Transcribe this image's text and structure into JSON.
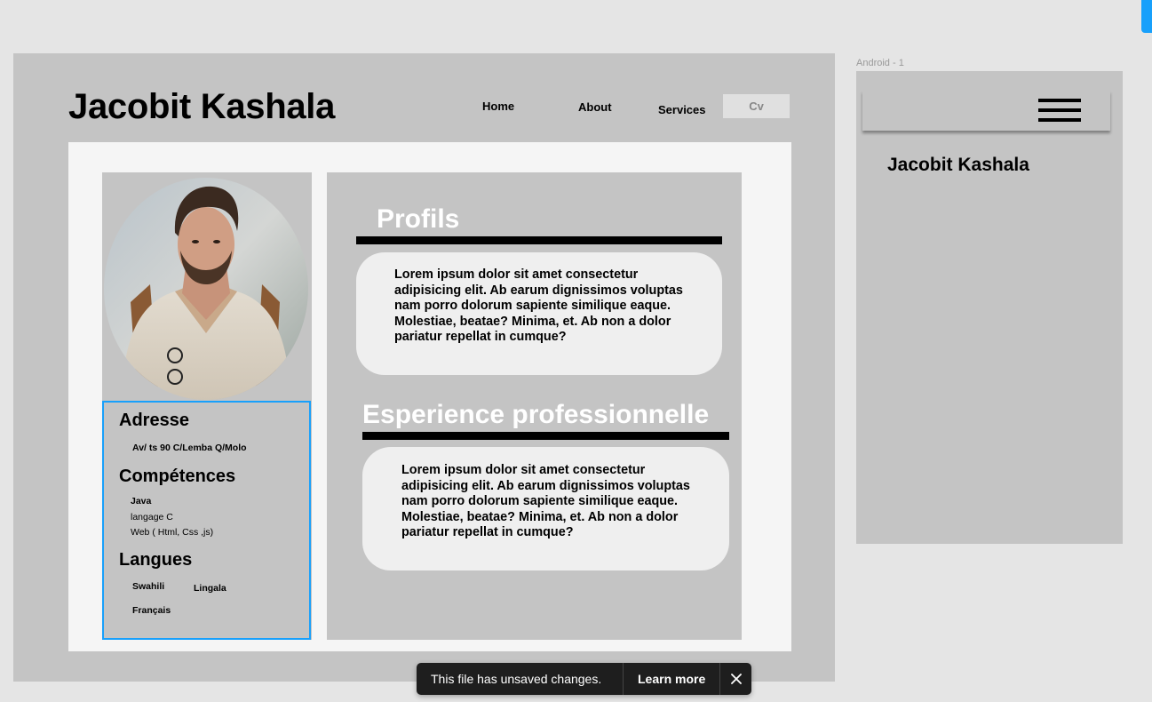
{
  "desktop": {
    "site_title": "Jacobit Kashala",
    "nav": {
      "home": "Home",
      "about": "About",
      "services": "Services",
      "cv": "Cv"
    },
    "sidebar": {
      "adresse_heading": "Adresse",
      "adresse_value": "Av/ ts 90 C/Lemba Q/Molo",
      "competences_heading": "Compétences",
      "competences_items": [
        "Java",
        "langage C",
        "Web ( Html, Css ,js)"
      ],
      "langues_heading": "Langues",
      "langues_items": [
        "Swahili",
        "Lingala",
        "Français"
      ]
    },
    "sections": {
      "profils_title": "Profils",
      "profils_text": "Lorem ipsum dolor sit amet consectetur adipisicing elit. Ab earum dignissimos voluptas nam porro dolorum sapiente similique eaque. Molestiae, beatae? Minima, et. Ab non a dolor pariatur repellat in cumque?",
      "experience_title": "Esperience professionnelle",
      "experience_text": "Lorem ipsum dolor sit amet consectetur adipisicing elit. Ab earum dignissimos voluptas nam porro dolorum sapiente similique eaque. Molestiae, beatae? Minima, et. Ab non a dolor pariatur repellat in cumque?"
    }
  },
  "android": {
    "frame_label": "Android - 1",
    "title": "Jacobit Kashala",
    "menu_icon": "hamburger-icon"
  },
  "toast": {
    "message": "This file has unsaved changes.",
    "learn_more": "Learn more",
    "close_icon": "close-icon"
  },
  "colors": {
    "canvas": "#e5e5e5",
    "frame": "#c4c4c4",
    "panel": "#f5f5f5",
    "card": "#efefef",
    "selection": "#18a0fb",
    "toast_bg": "#1e1e1e"
  }
}
